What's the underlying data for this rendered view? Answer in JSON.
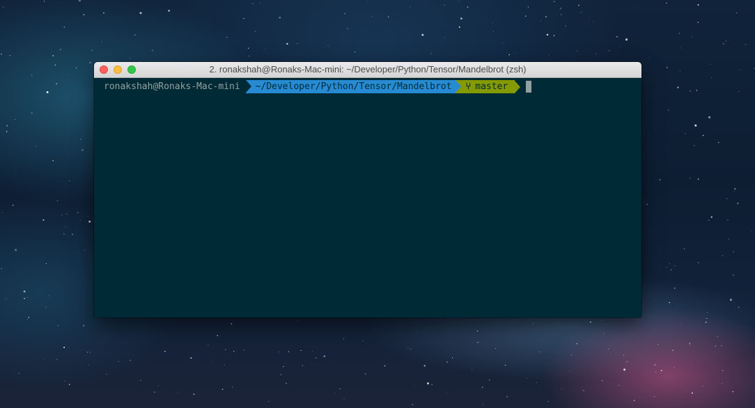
{
  "window": {
    "title": "2. ronakshah@Ronaks-Mac-mini: ~/Developer/Python/Tensor/Mandelbrot (zsh)",
    "controls": [
      "close",
      "minimize",
      "zoom"
    ]
  },
  "prompt": {
    "user_host": "ronakshah@Ronaks-Mac-mini",
    "path": "~/Developer/Python/Tensor/Mandelbrot",
    "branch_icon": "git-branch-icon",
    "branch": "master"
  },
  "colors": {
    "terminal_bg": "#002b36",
    "user_fg": "#93a1a1",
    "path_bg": "#268bd2",
    "git_bg": "#859900",
    "cursor": "#93a1a1"
  }
}
